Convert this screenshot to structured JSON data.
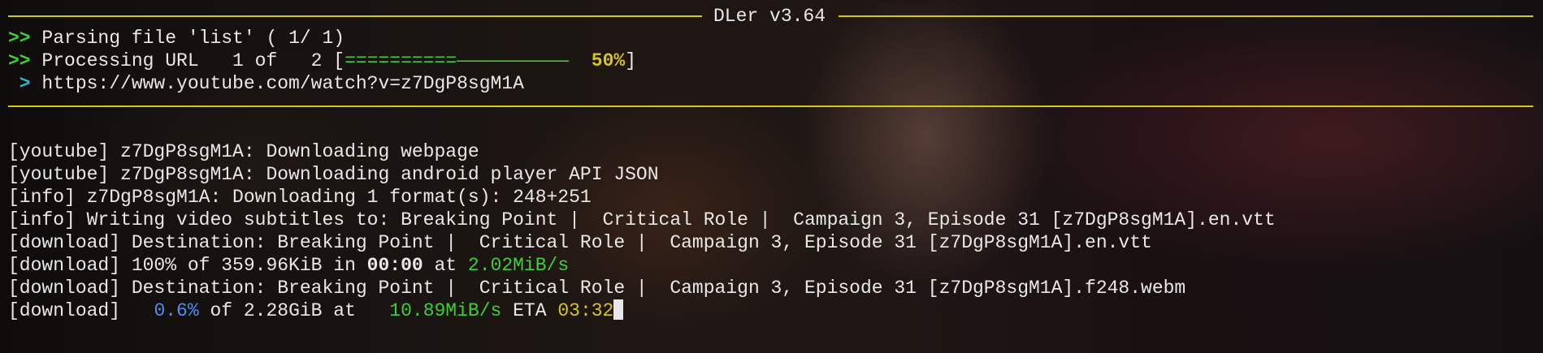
{
  "header": {
    "title": "DLer v3.64"
  },
  "status": {
    "prompt": ">>",
    "parse_text": "Parsing file 'list' ( 1/ 1)",
    "process_text": "Processing URL   1 of   2 ",
    "bar_open": "[",
    "bar_filled": "==========",
    "bar_empty": "——————————",
    "percent": "50%",
    "bar_close": "]",
    "progress_fraction": 0.5,
    "url_prompt": " >",
    "url": " https://www.youtube.com/watch?v=z7DgP8sgM1A"
  },
  "log": {
    "l1": "[youtube] z7DgP8sgM1A: Downloading webpage",
    "l2": "[youtube] z7DgP8sgM1A: Downloading android player API JSON",
    "l3": "[info] z7DgP8sgM1A: Downloading 1 format(s): 248+251",
    "l4": "[info] Writing video subtitles to: Breaking Point |  Critical Role |  Campaign 3, Episode 31 [z7DgP8sgM1A].en.vtt",
    "l5": "[download] Destination: Breaking Point |  Critical Role |  Campaign 3, Episode 31 [z7DgP8sgM1A].en.vtt",
    "l6": {
      "prefix": "[download] 100% of 359.96KiB in ",
      "time": "00:00",
      "mid": " at ",
      "speed": "2.02MiB/s"
    },
    "l7": "[download] Destination: Breaking Point |  Critical Role |  Campaign 3, Episode 31 [z7DgP8sgM1A].f248.webm",
    "l8": {
      "prefix": "[download]   ",
      "pct": "0.6%",
      "of": " of 2.28GiB at   ",
      "speed": "10.89MiB/s",
      "eta_label": " ETA ",
      "eta": "03:32"
    }
  },
  "colors": {
    "accent_yellow": "#d6c41f",
    "prompt_green": "#3fcf35",
    "url_cyan": "#2fb6c8",
    "percent_blue": "#4d8ff0"
  }
}
